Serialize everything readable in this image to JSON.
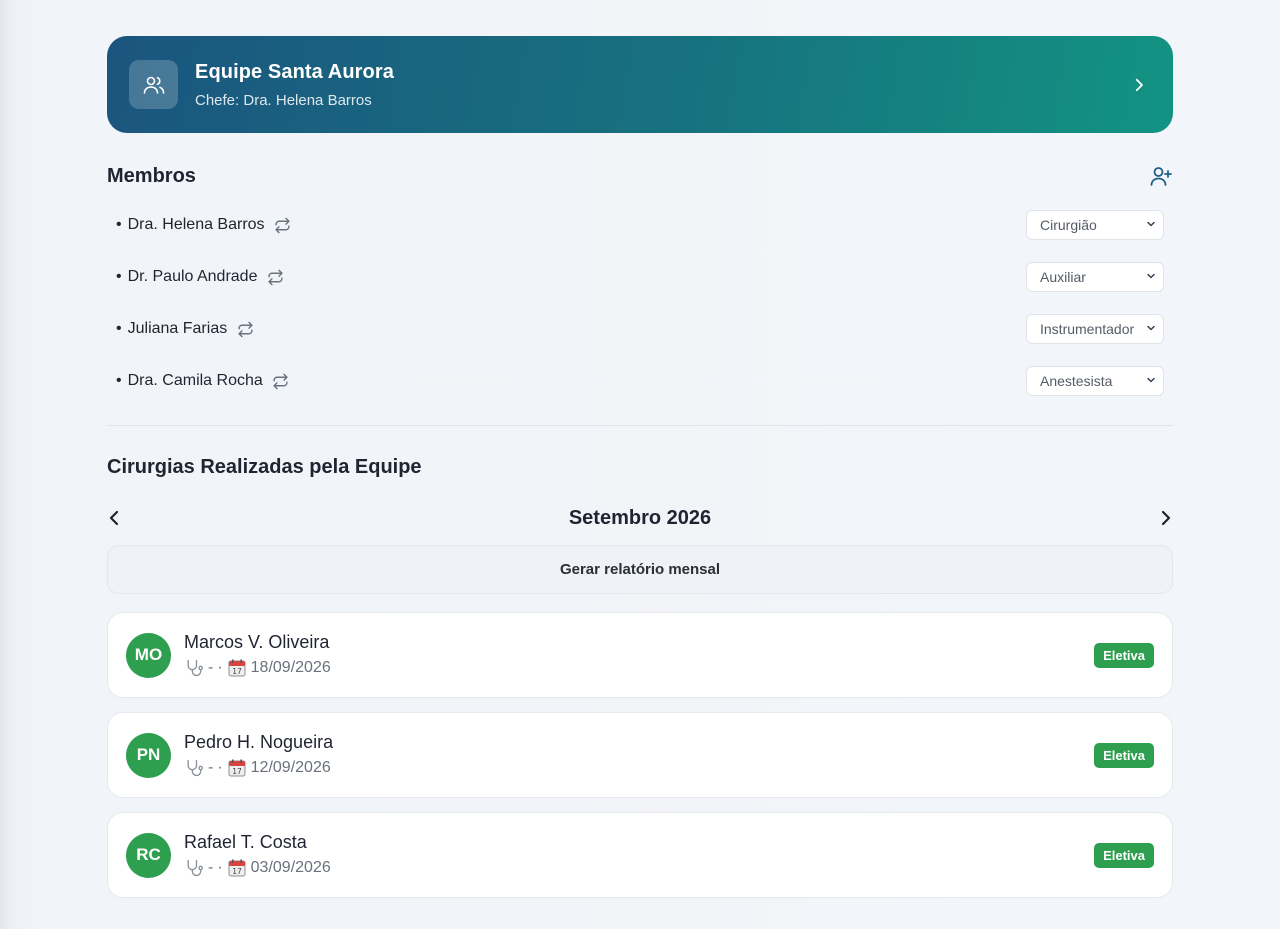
{
  "team": {
    "name": "Equipe Santa Aurora",
    "chief": "Chefe: Dra. Helena Barros"
  },
  "members_section": {
    "title": "Membros",
    "items": [
      {
        "name": "Dra. Helena Barros",
        "role": "Cirurgião"
      },
      {
        "name": "Dr. Paulo Andrade",
        "role": "Auxiliar"
      },
      {
        "name": "Juliana Farias",
        "role": "Instrumentador"
      },
      {
        "name": "Dra. Camila Rocha",
        "role": "Anestesista"
      }
    ]
  },
  "surgeries_section": {
    "title": "Cirurgias Realizadas pela Equipe",
    "month": "Setembro 2026",
    "prev_label": "‹",
    "next_label": "›",
    "report_button": "Gerar relatório mensal",
    "items": [
      {
        "initials": "MO",
        "patient": "Marcos V. Oliveira",
        "procedure": "-",
        "date": "18/09/2026",
        "type": "Eletiva"
      },
      {
        "initials": "PN",
        "patient": "Pedro H. Nogueira",
        "procedure": "-",
        "date": "12/09/2026",
        "type": "Eletiva"
      },
      {
        "initials": "RC",
        "patient": "Rafael T. Costa",
        "procedure": "-",
        "date": "03/09/2026",
        "type": "Eletiva"
      }
    ]
  },
  "colors": {
    "header_gradient_start": "#1b557f",
    "header_gradient_end": "#129382",
    "accent_green": "#2e9e4f",
    "icon_blue": "#1f5f86"
  },
  "icons": {
    "team": "users-icon",
    "chevron": "chevron-right-icon",
    "add_member": "user-plus-icon",
    "swap": "swap-icon",
    "select": "chevron-down-icon",
    "procedure": "stethoscope-icon",
    "date": "calendar-icon"
  }
}
